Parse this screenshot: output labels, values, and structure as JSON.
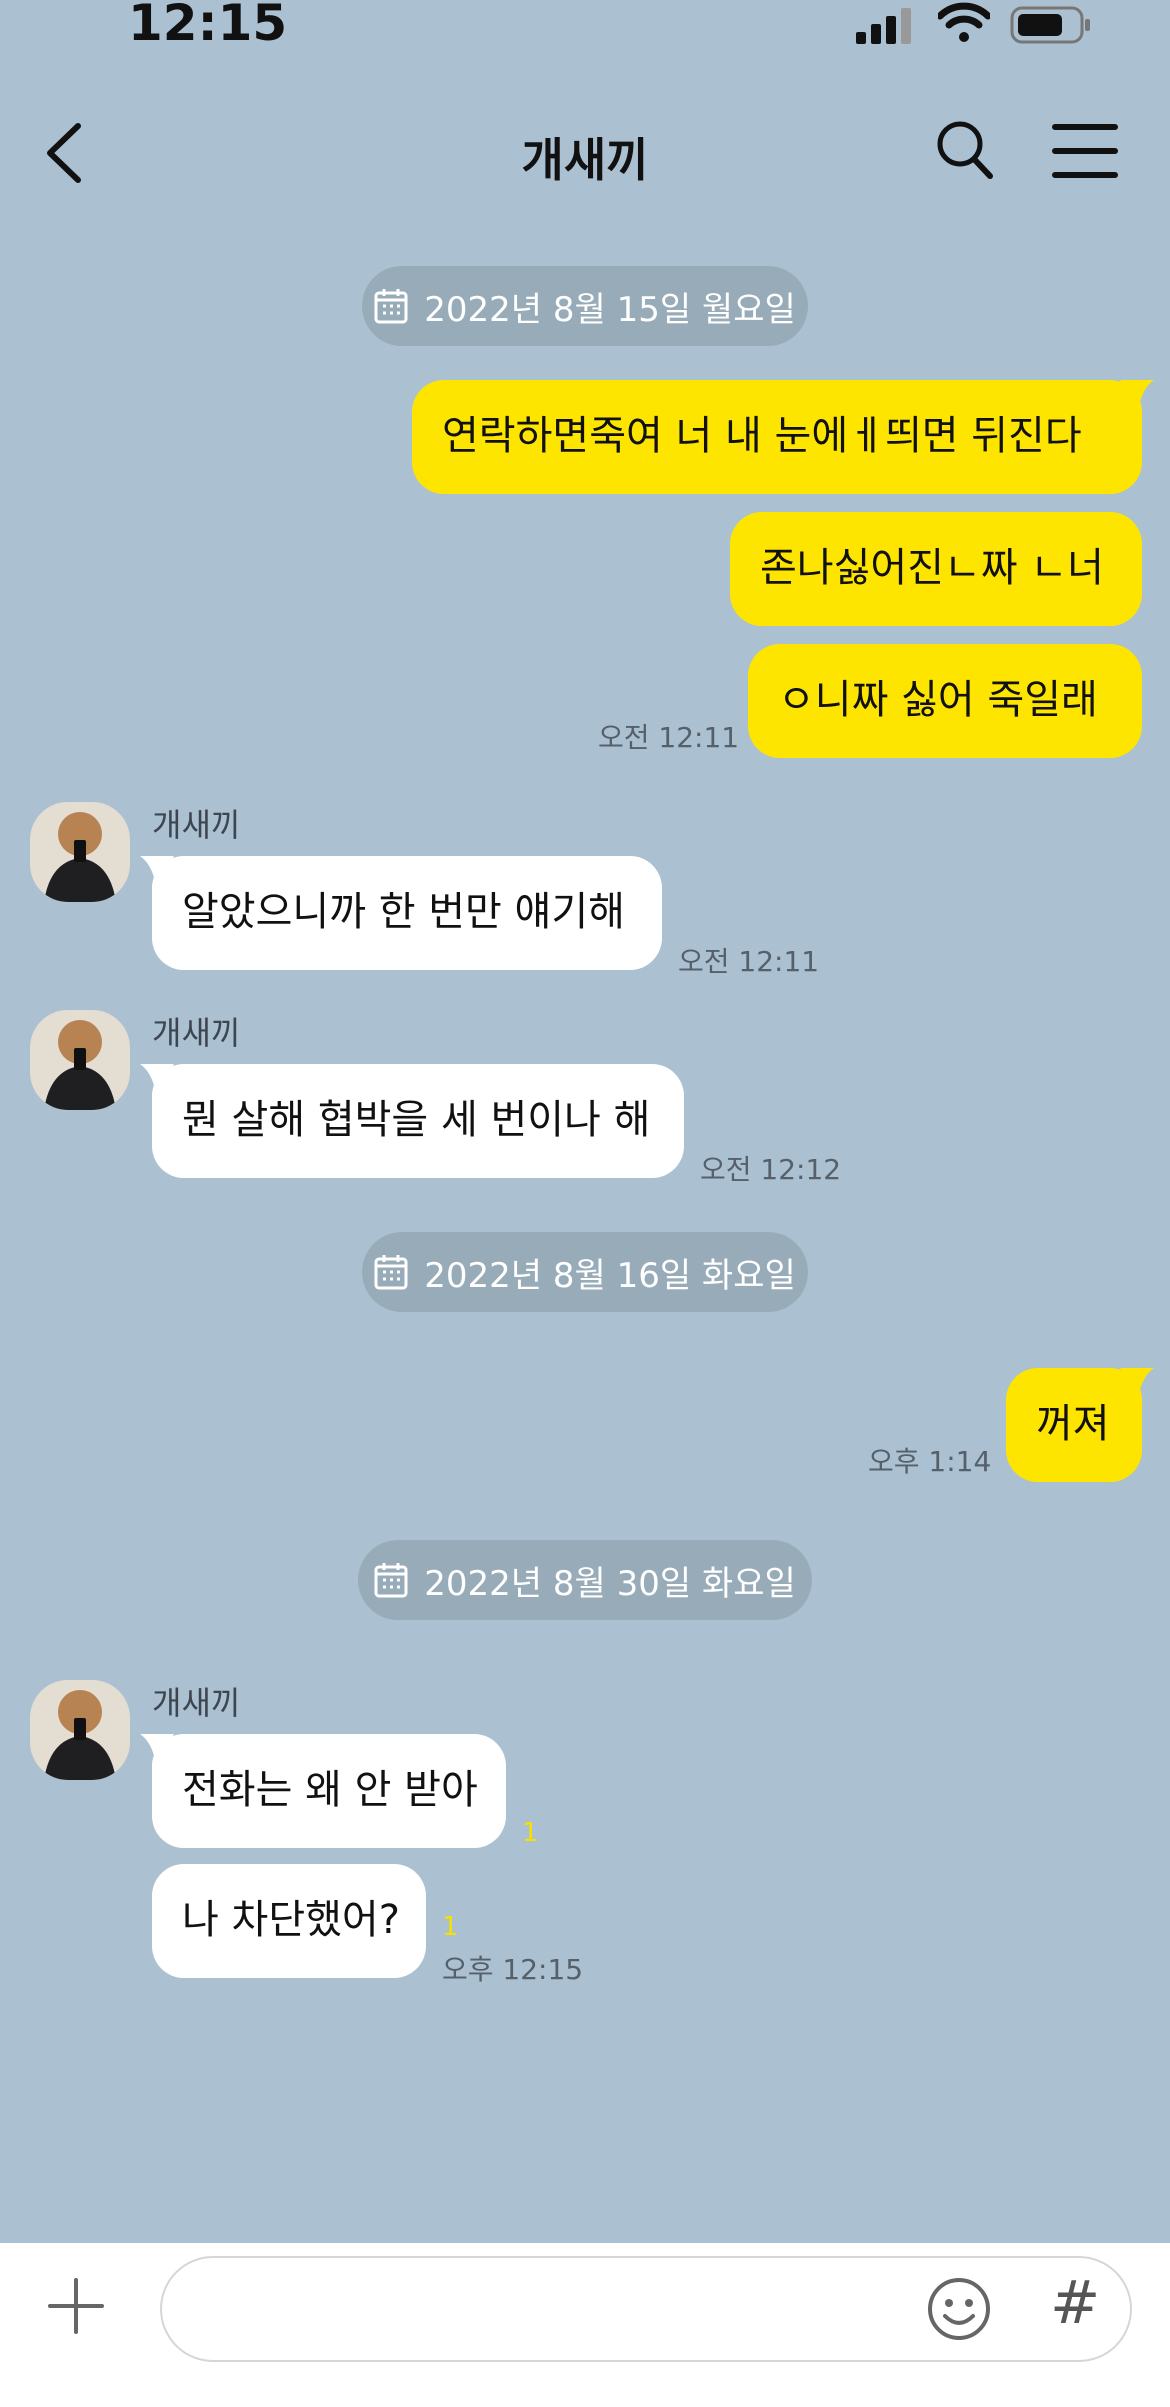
{
  "status_bar": {
    "time": "12:15"
  },
  "header": {
    "title": "개새끼",
    "back_icon": "back-chevron-icon",
    "search_icon": "search-icon",
    "menu_icon": "menu-icon"
  },
  "dates": [
    "2022년 8월 15일 월요일",
    "2022년 8월 16일 화요일",
    "2022년 8월 30일 화요일"
  ],
  "messages": {
    "m1": "연락하면죽여 너 내 눈에ㅔ띄면 뒤진다",
    "m2": "존나싫어진ㄴ짜 ㄴ너",
    "m3": "ㅇ니짜 싫어 죽일래",
    "m3_time": "오전 12:11",
    "sender": "개새끼",
    "m4": "알았으니까 한 번만 얘기해",
    "m4_time": "오전 12:11",
    "m5": "뭔 살해 협박을 세 번이나 해",
    "m5_time": "오전 12:12",
    "m6": "꺼져",
    "m6_time": "오후 1:14",
    "m7": "전화는 왜 안 받아",
    "m7_unread": "1",
    "m8": "나 차단했어?",
    "m8_unread": "1",
    "m8_time": "오후 12:15"
  },
  "input": {
    "placeholder": "",
    "hash": "#"
  },
  "colors": {
    "background": "#abc1d1",
    "my_bubble": "#fee500",
    "their_bubble": "#ffffff",
    "date_pill": "#98abb8"
  }
}
